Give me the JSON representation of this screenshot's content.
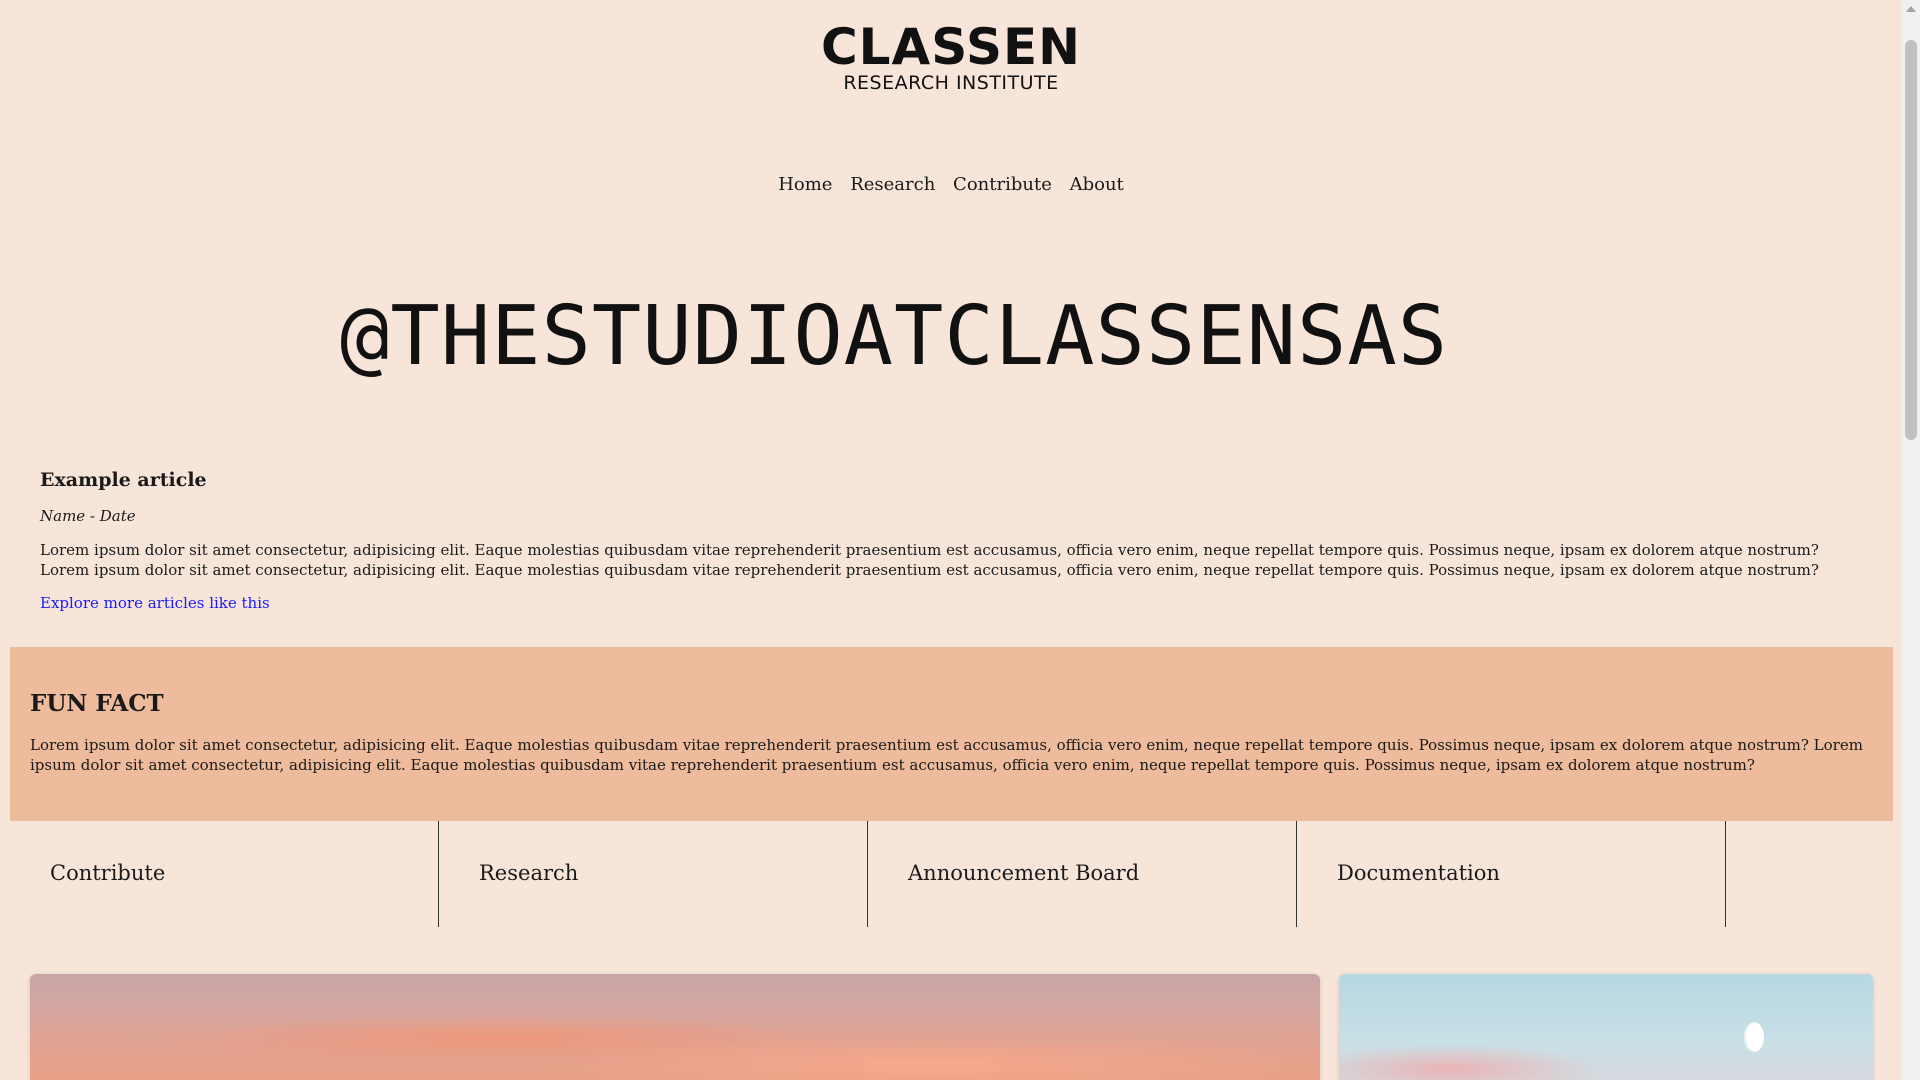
{
  "logo": {
    "main": "CLASSEN",
    "sub": "RESEARCH INSTITUTE"
  },
  "nav": {
    "items": [
      "Home",
      "Research",
      "Contribute",
      "About"
    ]
  },
  "hero": {
    "handle": "@THESTUDIOATCLASSENSAS"
  },
  "article": {
    "title": "Example article",
    "meta": "Name - Date",
    "body": "Lorem ipsum dolor sit amet consectetur, adipisicing elit. Eaque molestias quibusdam vitae reprehenderit praesentium est accusamus, officia vero enim, neque repellat tempore quis. Possimus neque, ipsam ex dolorem atque nostrum? Lorem ipsum dolor sit amet consectetur, adipisicing elit. Eaque molestias quibusdam vitae reprehenderit praesentium est accusamus, officia vero enim, neque repellat tempore quis. Possimus neque, ipsam ex dolorem atque nostrum?",
    "more_link": "Explore more articles like this"
  },
  "funfact": {
    "title": "FUN FACT",
    "body": "Lorem ipsum dolor sit amet consectetur, adipisicing elit. Eaque molestias quibusdam vitae reprehenderit praesentium est accusamus, officia vero enim, neque repellat tempore quis. Possimus neque, ipsam ex dolorem atque nostrum? Lorem ipsum dolor sit amet consectetur, adipisicing elit. Eaque molestias quibusdam vitae reprehenderit praesentium est accusamus, officia vero enim, neque repellat tempore quis. Possimus neque, ipsam ex dolorem atque nostrum?"
  },
  "boxes": [
    "Contribute",
    "Research",
    "Announcement Board",
    "Documentation"
  ],
  "colors": {
    "background": "#f8e5da",
    "funfact_bg": "#efbb9d",
    "link": "#1a1aff"
  }
}
